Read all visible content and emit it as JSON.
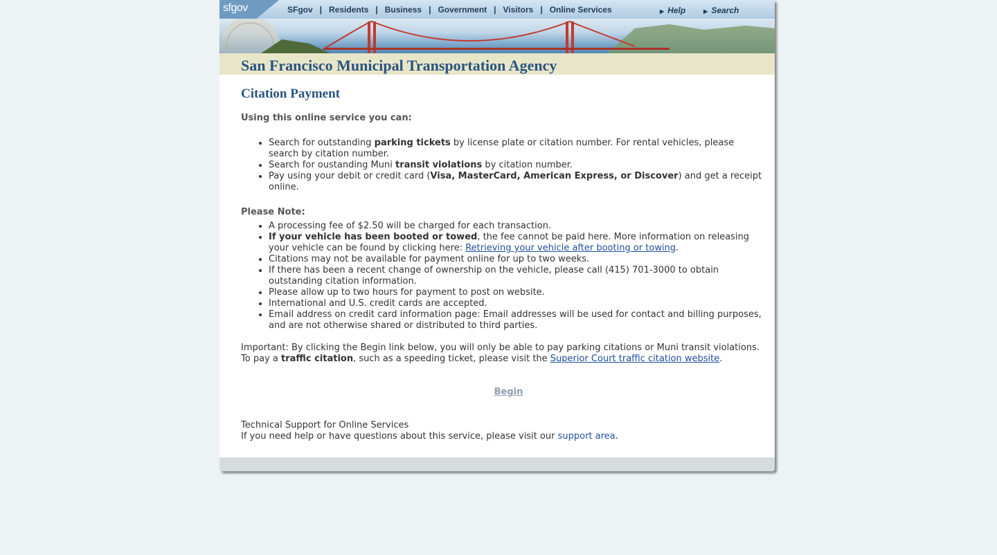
{
  "topnav": {
    "logo": "sfgov",
    "links": [
      "SFgov",
      "Residents",
      "Business",
      "Government",
      "Visitors",
      "Online Services"
    ],
    "separator": "|",
    "help": "Help",
    "search": "Search"
  },
  "header": {
    "agency": "San Francisco Municipal Transportation Agency"
  },
  "main": {
    "title": "Citation Payment",
    "intro": "Using this online service you can:",
    "can_items": [
      {
        "pre": "Search for outstanding ",
        "bold": "parking tickets",
        "post": " by license plate or citation number. For rental vehicles, please search by citation number."
      },
      {
        "pre": "Search for oustanding Muni ",
        "bold": "transit violations",
        "post": " by citation number."
      },
      {
        "pre": "Pay using your debit or credit card (",
        "bold": "Visa, MasterCard, American Express, or Discover",
        "post": ") and get a receipt online."
      }
    ],
    "note_heading": "Please Note:",
    "notes": {
      "fee": "A processing fee of $2.50 will be charged for each transaction.",
      "booted_bold": "If your vehicle has been booted or towed",
      "booted_text": ", the fee cannot be paid here. More information on releasing your vehicle can be found by clicking here: ",
      "booted_link": "Retrieving your vehicle after booting or towing",
      "booted_end": ".",
      "availability": "Citations may not be available for payment online for up to two weeks.",
      "ownership": "If there has been a recent change of ownership on the vehicle, please call (415) 701-3000 to obtain outstanding citation information.",
      "posting": "Please allow up to two hours for payment to post on website.",
      "cards": "International and U.S. credit cards are accepted.",
      "email": "Email address on credit card information page: Email addresses will be used for contact and billing purposes, and are not otherwise shared or distributed to third parties."
    },
    "important": {
      "pre": "Important: By clicking the Begin link below, you will only be able to pay parking citations or Muni transit violations. To pay a ",
      "bold": "traffic citation",
      "mid": ", such as a speeding ticket, please visit the ",
      "link": "Superior Court traffic citation website",
      "end": "."
    },
    "begin": "Begin",
    "support_title": "Technical Support for Online Services",
    "support_text": "If you need help or have questions about this service, please visit our ",
    "support_link": "support area",
    "support_end": "."
  }
}
